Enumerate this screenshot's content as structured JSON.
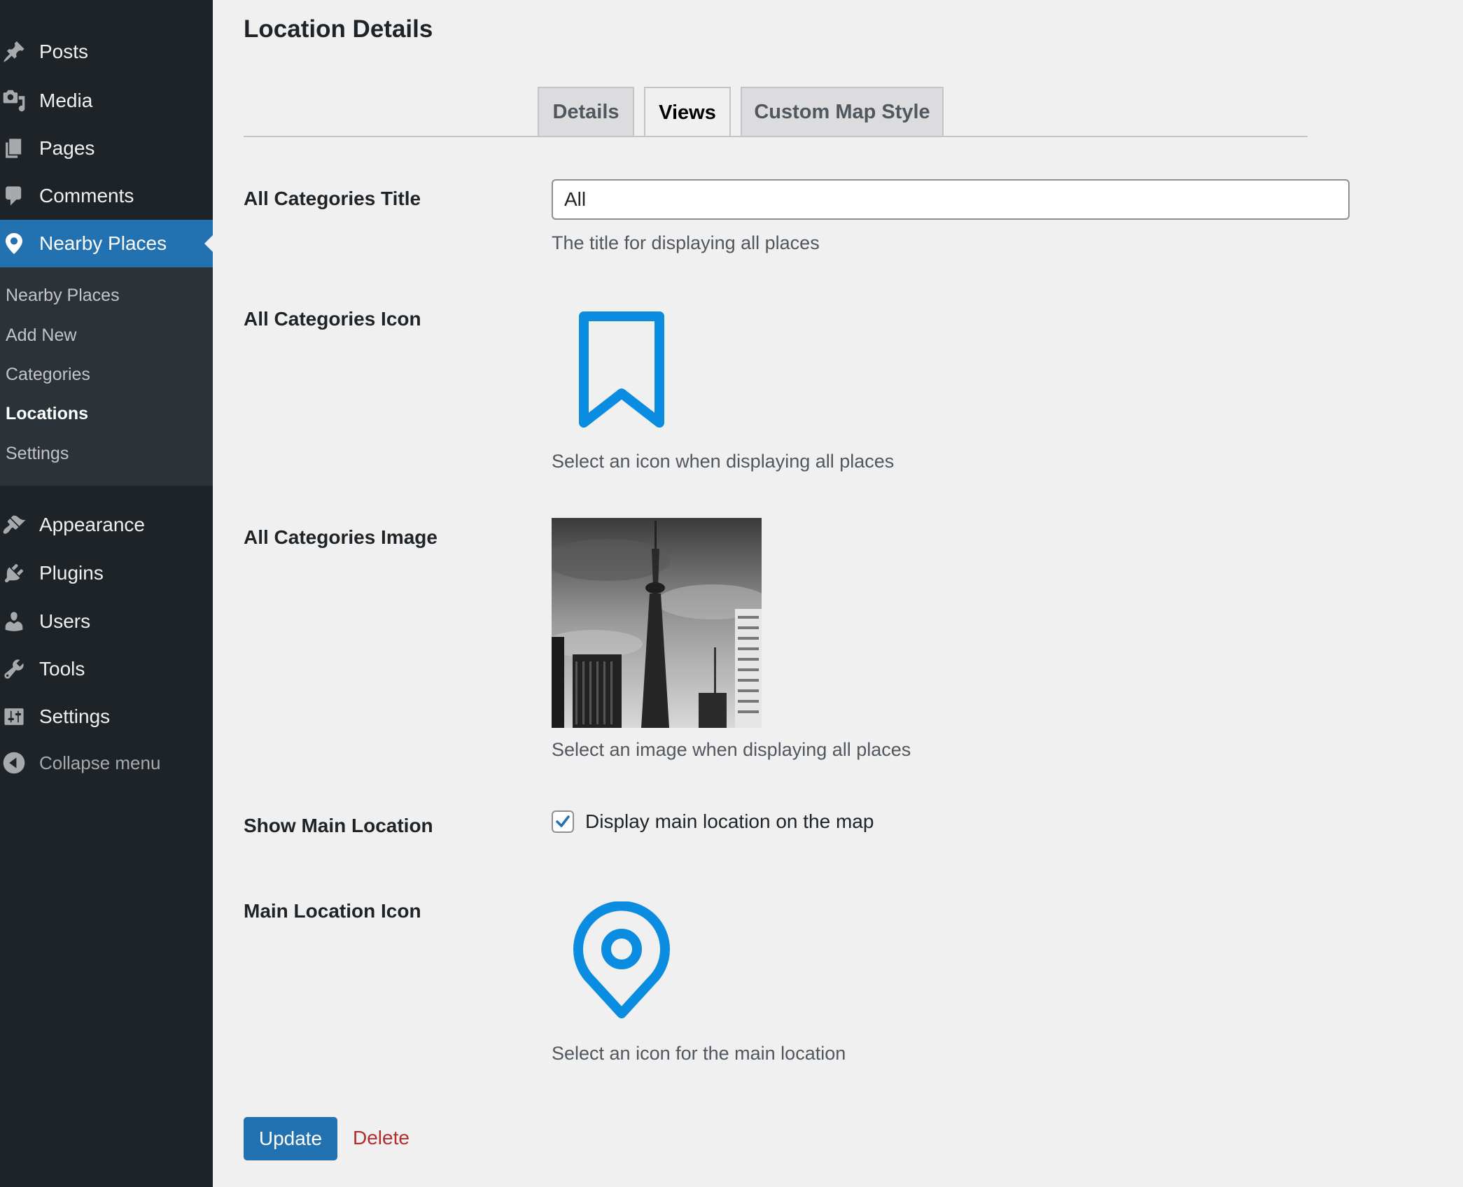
{
  "sidebar": {
    "top_items": [
      {
        "label": "Posts",
        "icon": "pin-icon"
      },
      {
        "label": "Media",
        "icon": "media-icon"
      },
      {
        "label": "Pages",
        "icon": "pages-icon"
      },
      {
        "label": "Comments",
        "icon": "comment-icon"
      }
    ],
    "active_item": {
      "label": "Nearby Places",
      "icon": "location-pin-icon"
    },
    "submenu": [
      "Nearby Places",
      "Add New",
      "Categories",
      "Locations",
      "Settings"
    ],
    "submenu_current": "Locations",
    "bottom_items": [
      {
        "label": "Appearance",
        "icon": "brush-icon"
      },
      {
        "label": "Plugins",
        "icon": "plug-icon"
      },
      {
        "label": "Users",
        "icon": "user-icon"
      },
      {
        "label": "Tools",
        "icon": "wrench-icon"
      },
      {
        "label": "Settings",
        "icon": "settings-sliders-icon"
      }
    ],
    "collapse_label": "Collapse menu"
  },
  "main": {
    "title": "Location Details",
    "tabs": [
      {
        "label": "Details",
        "active": false
      },
      {
        "label": "Views",
        "active": true
      },
      {
        "label": "Custom Map Style",
        "active": false
      }
    ],
    "fields": {
      "all_categories_title": {
        "label": "All Categories Title",
        "value": "All",
        "description": "The title for displaying all places"
      },
      "all_categories_icon": {
        "label": "All Categories Icon",
        "icon": "bookmark-icon",
        "description": "Select an icon when displaying all places"
      },
      "all_categories_image": {
        "label": "All Categories Image",
        "description": "Select an image when displaying all places"
      },
      "show_main_location": {
        "label": "Show Main Location",
        "checked": true,
        "checkbox_label": "Display main location on the map"
      },
      "main_location_icon": {
        "label": "Main Location Icon",
        "icon": "location-target-icon",
        "description": "Select an icon for the main location"
      }
    },
    "actions": {
      "update_label": "Update",
      "delete_label": "Delete"
    }
  },
  "colors": {
    "sidebar_bg": "#1d2327",
    "submenu_bg": "#2c3338",
    "accent": "#2271b1",
    "icon_blue": "#0a8ce0",
    "delete": "#b32d2e"
  }
}
